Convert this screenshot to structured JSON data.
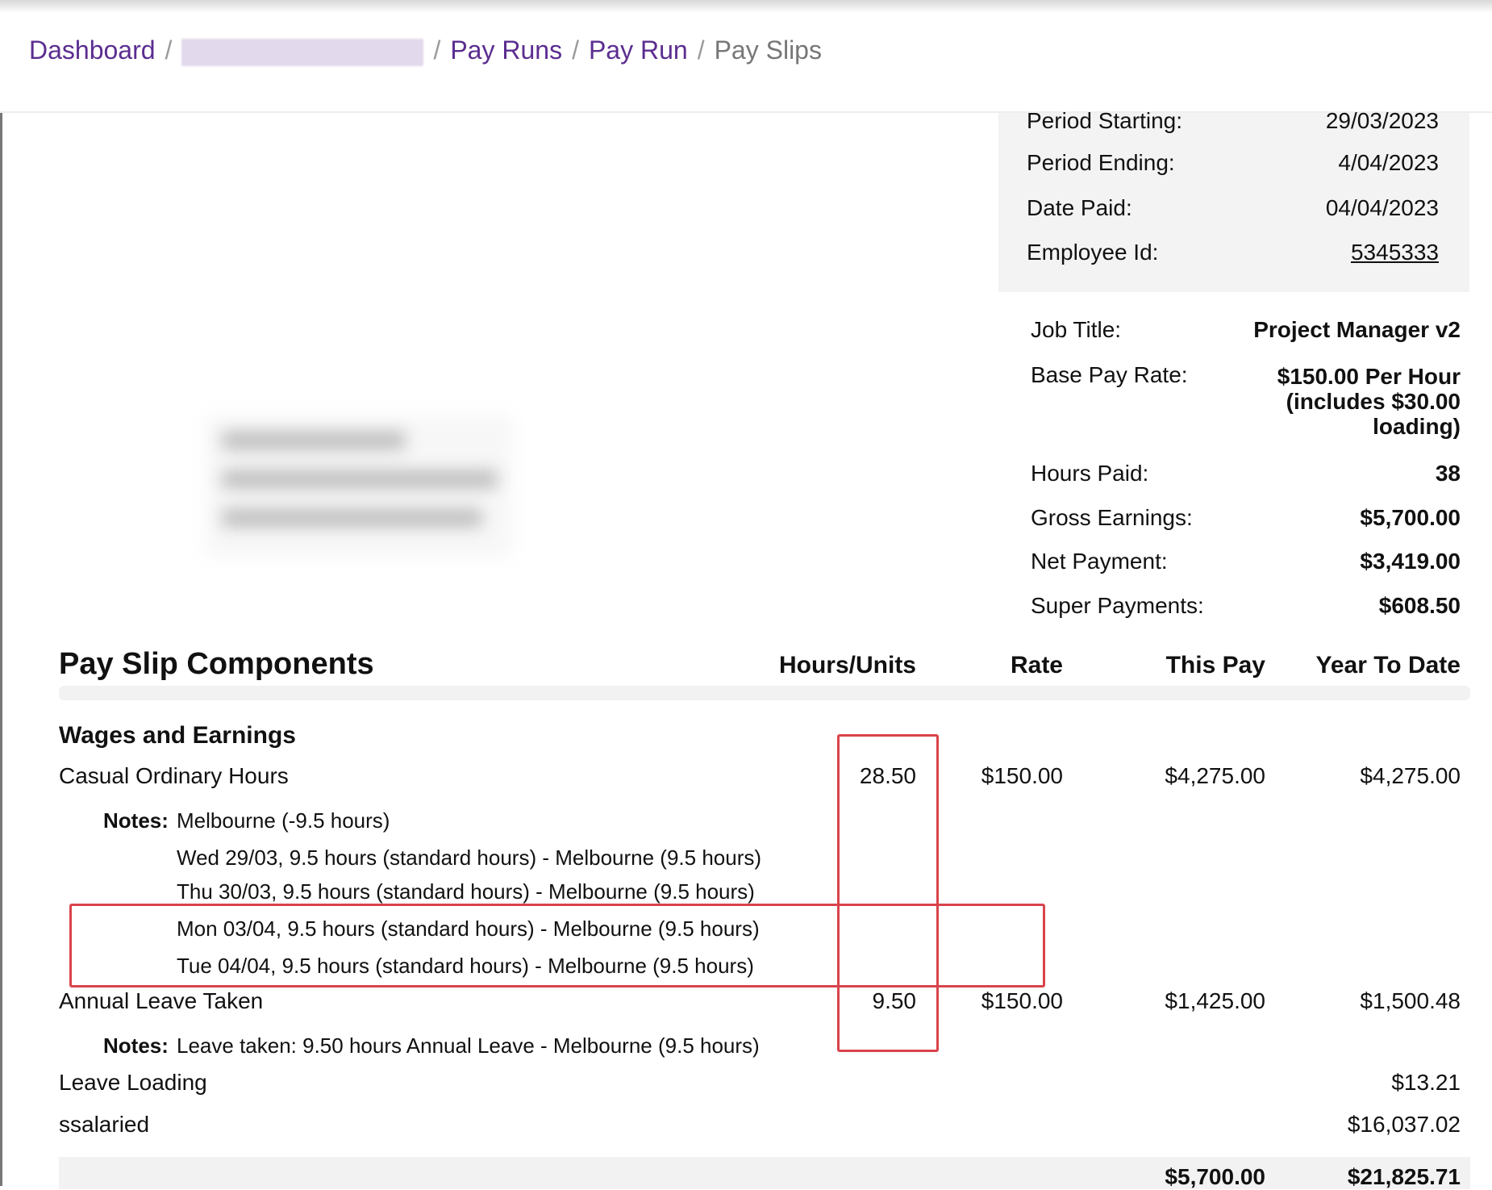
{
  "breadcrumb": {
    "dashboard": "Dashboard",
    "pay_runs": "Pay Runs",
    "pay_run": "Pay Run",
    "pay_slips": "Pay Slips",
    "separator": "/"
  },
  "period": {
    "starting_label": "Period Starting:",
    "starting_value": "29/03/2023",
    "ending_label": "Period Ending:",
    "ending_value": "4/04/2023",
    "paid_label": "Date Paid:",
    "paid_value": "04/04/2023",
    "employee_label": "Employee Id:",
    "employee_value": "5345333"
  },
  "summary": {
    "job_title_label": "Job Title:",
    "job_title_value": "Project Manager v2",
    "base_rate_label": "Base Pay Rate:",
    "base_rate_line1": "$150.00 Per Hour",
    "base_rate_line2": "(includes $30.00",
    "base_rate_line3": "loading)",
    "hours_paid_label": "Hours Paid:",
    "hours_paid_value": "38",
    "gross_label": "Gross Earnings:",
    "gross_value": "$5,700.00",
    "net_label": "Net Payment:",
    "net_value": "$3,419.00",
    "super_label": "Super Payments:",
    "super_value": "$608.50"
  },
  "components": {
    "title": "Pay Slip Components",
    "columns": {
      "hours": "Hours/Units",
      "rate": "Rate",
      "this_pay": "This Pay",
      "ytd": "Year To Date"
    },
    "group_title": "Wages and Earnings",
    "casual": {
      "name": "Casual Ordinary Hours",
      "hours": "28.50",
      "rate": "$150.00",
      "this_pay": "$4,275.00",
      "ytd": "$4,275.00",
      "notes_label": "Notes:",
      "notes": [
        "Melbourne (-9.5 hours)",
        "Wed 29/03, 9.5 hours (standard hours) - Melbourne (9.5 hours)",
        "Thu 30/03, 9.5 hours (standard hours) - Melbourne (9.5 hours)",
        "Mon 03/04, 9.5 hours (standard hours) - Melbourne (9.5 hours)",
        "Tue 04/04, 9.5 hours (standard hours) - Melbourne (9.5 hours)"
      ]
    },
    "annual_leave": {
      "name": "Annual Leave Taken",
      "hours": "9.50",
      "rate": "$150.00",
      "this_pay": "$1,425.00",
      "ytd": "$1,500.48",
      "notes_label": "Notes:",
      "note": "Leave taken: 9.50 hours Annual Leave - Melbourne (9.5 hours)"
    },
    "leave_loading": {
      "name": "Leave Loading",
      "ytd": "$13.21"
    },
    "ssalaried": {
      "name": "ssalaried",
      "ytd": "$16,037.02"
    },
    "totals": {
      "this_pay": "$5,700.00",
      "ytd": "$21,825.71"
    }
  },
  "colors": {
    "link": "#5b2d90",
    "highlight": "#d9434b",
    "panel": "#f3f3f3"
  }
}
